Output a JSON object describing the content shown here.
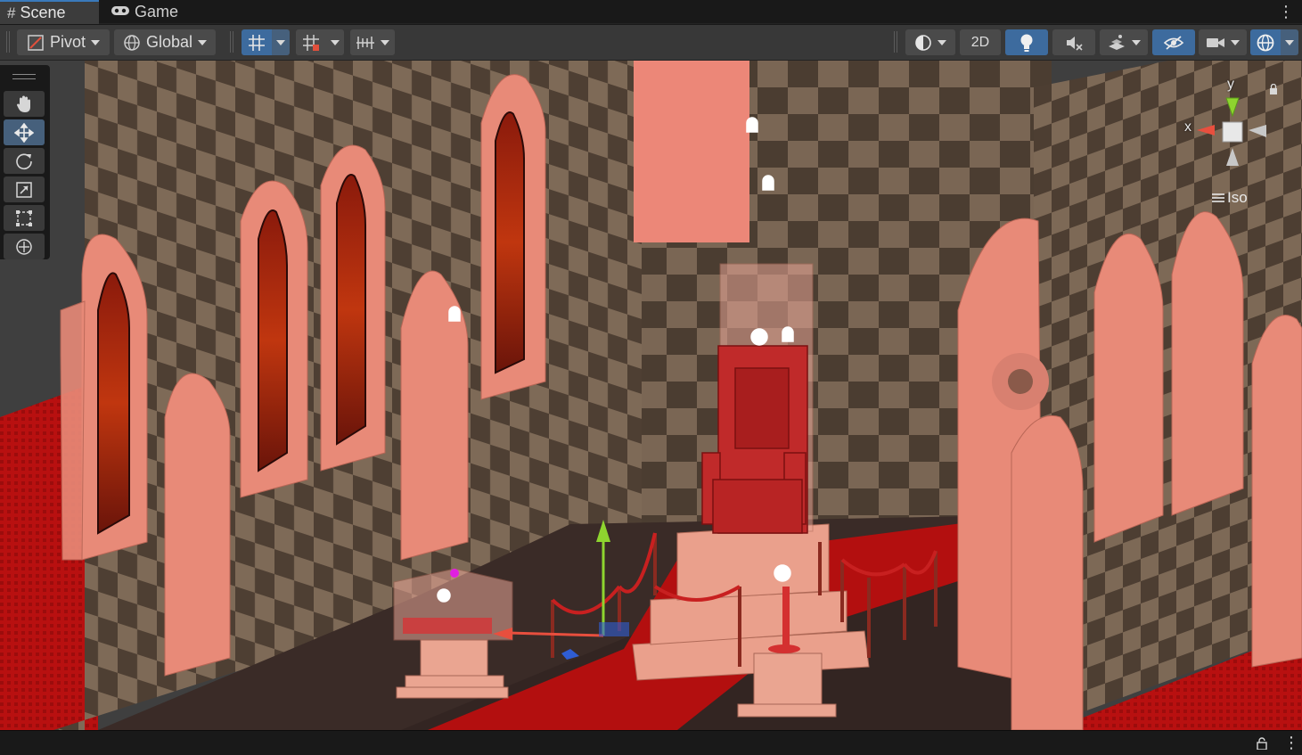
{
  "tabs": [
    {
      "label": "Scene",
      "icon": "hash-icon",
      "active": true
    },
    {
      "label": "Game",
      "icon": "gamepad-icon",
      "active": false
    }
  ],
  "toolbar": {
    "pivot_label": "Pivot",
    "global_label": "Global",
    "mode_2d_label": "2D"
  },
  "tools": [
    {
      "name": "hand-tool",
      "active": false
    },
    {
      "name": "move-tool",
      "active": true
    },
    {
      "name": "rotate-tool",
      "active": false
    },
    {
      "name": "scale-tool",
      "active": false
    },
    {
      "name": "rect-tool",
      "active": false
    },
    {
      "name": "transform-tool",
      "active": false
    }
  ],
  "gizmo": {
    "x_label": "x",
    "y_label": "y",
    "projection_label": "Iso"
  },
  "colors": {
    "accent": "#3a79bb",
    "active_button": "#46607c",
    "floor_red": "#a80f0f",
    "wall_salmon": "#e88a78",
    "axis_x": "#e84f3e",
    "axis_y": "#8ed42f",
    "axis_z": "#2f5dd3"
  }
}
